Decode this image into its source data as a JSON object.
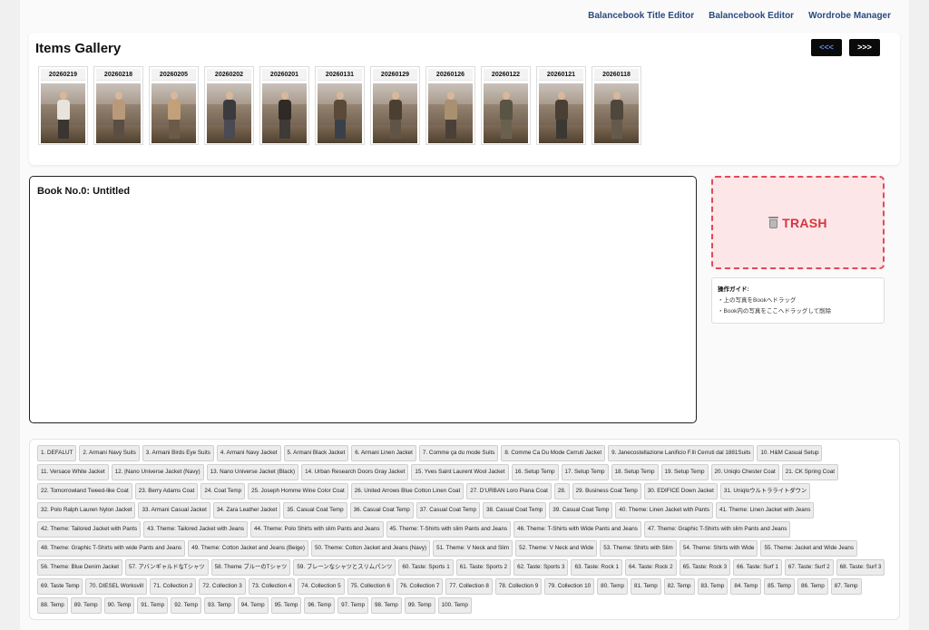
{
  "nav": {
    "links": [
      "Balancebook Title Editor",
      "Balancebook Editor",
      "Wordrobe Manager"
    ]
  },
  "gallery": {
    "title": "Items Gallery",
    "prev_label": "<<<",
    "next_label": ">>>",
    "items": [
      {
        "date": "20260219",
        "coat": "#e8e3dc",
        "pants": "#3a3530"
      },
      {
        "date": "20260218",
        "coat": "#b89a7a",
        "pants": "#5a4e43"
      },
      {
        "date": "20260205",
        "coat": "#c2a07a",
        "pants": "#6b5a48"
      },
      {
        "date": "20260202",
        "coat": "#3b3a3c",
        "pants": "#4a4a52"
      },
      {
        "date": "20260201",
        "coat": "#2f2a26",
        "pants": "#3d3a37"
      },
      {
        "date": "20260131",
        "coat": "#5b4a38",
        "pants": "#394049"
      },
      {
        "date": "20260129",
        "coat": "#4b3f31",
        "pants": "#5f5446"
      },
      {
        "date": "20260126",
        "coat": "#a89070",
        "pants": "#4a4038"
      },
      {
        "date": "20260122",
        "coat": "#5a5445",
        "pants": "#6a604e"
      },
      {
        "date": "20260121",
        "coat": "#4a3f34",
        "pants": "#3b3834"
      },
      {
        "date": "20260118",
        "coat": "#4f473c",
        "pants": "#645a4c"
      }
    ]
  },
  "book": {
    "title": "Book No.0: Untitled"
  },
  "trash": {
    "label": "TRASH"
  },
  "guide": {
    "title": "操作ガイド:",
    "lines": [
      "・上の写真をBookへドラッグ",
      "・Book内の写真をここへドラッグして削除"
    ]
  },
  "books": [
    "1. DEFALUT",
    "2. Armani Navy Suits",
    "3. Armani Birds Eye Suits",
    "4. Armani Navy Jacket",
    "5. Armani Black Jacket",
    "6. Armani Linen Jacket",
    "7. Comme ça du mode Suits",
    "8. Comme Ca Du Mode Cerruti Jacket",
    "9. Janecostellazione Lanificio F.lli Cerruti dal 1881Suits",
    "10. H&M Casual Setup",
    "11. Versace White Jacket",
    "12. |Nano Universe Jacket (Navy)",
    "13. Nano Universe Jacket (Black)",
    "14. Urban Research Doors Gray Jacket",
    "15. Yves Saint Laurent Wool Jacket",
    "16. Setup Temp",
    "17. Setup Temp",
    "18. Setup Temp",
    "19. Setup Temp",
    "20. Uniqlo Chester Coat",
    "21. CK Spring Coat",
    "22. Tomorrowland Tweed-like Coat",
    "23. Berry Adams Coat",
    "24. Coat Temp",
    "25. Joseph Homme Wine Color Coat",
    "26. United Arrows Blue Cotton Linen Coat",
    "27. D'URBAN Loro Piana Coat",
    "28.",
    "29. Business Coat Temp",
    "30. EDIFICE Down Jacket",
    "31. Uniqloウルトラライトダウン",
    "32. Polo Ralph Lauren Nylon Jacket",
    "33. Armani Casual Jacket",
    "34. Zara Leather Jacket",
    "35. Casual Coat Temp",
    "36. Casual Coat Temp",
    "37. Casual Coat Temp",
    "38. Casual Coat Temp",
    "39. Casual Coat Temp",
    "40. Theme: Linen Jacket with Pants",
    "41. Theme: Linen Jacket with Jeans",
    "42. Theme: Tailored Jacket with Pants",
    "43. Theme: Tailored Jacket with Jeans",
    "44. Theme: Polo Shirts with slim Pants and Jeans",
    "45. Theme: T-Shirts with slim Pants and Jeans",
    "46. Theme: T-Shirts with Wide Pants and Jeans",
    "47. Theme: Graphic T-Shirts with slim Pants and Jeans",
    "48. Theme: Graphic T-Shirts with wide Pants and Jeans",
    "49. Theme: Cotton Jacket and Jeans (Beige)",
    "50. Theme: Cotton Jacket and Jeans (Navy)",
    "51. Theme: V Neck and Slim",
    "52. Theme: V Neck and Wide",
    "53. Theme: Shirts with Slim",
    "54. Theme: Shirts with Wide",
    "55. Theme: Jacket and Wide Jeans",
    "56. Theme: Blue Denim Jacket",
    "57. アバンギャルドなTシャツ",
    "58. Theme ブルーのTシャツ",
    "59. プレーンなシャツとスリムパンツ",
    "60. Taste: Sports 1",
    "61. Taste: Sports 2",
    "62. Taste: Sports 3",
    "63. Taste: Rock 1",
    "64. Taste: Rock 2",
    "65. Taste: Rock 3",
    "66. Taste: Surf 1",
    "67. Taste: Surf 2",
    "68. Taste: Surf 3",
    "69. Taste Temp",
    "70. DIESEL Worksvill",
    "71. Collection 2",
    "72. Collection 3",
    "73. Collection 4",
    "74. Collection 5",
    "75. Collection 6",
    "76. Collection 7",
    "77. Collection 8",
    "78. Collection 9",
    "79. Collection 10",
    "80. Temp",
    "81. Temp",
    "82. Temp",
    "83. Temp",
    "84. Temp",
    "85. Temp",
    "86. Temp",
    "87. Temp",
    "88. Temp",
    "89. Temp",
    "90. Temp",
    "91. Temp",
    "92. Temp",
    "93. Temp",
    "94. Temp",
    "95. Temp",
    "96. Temp",
    "97. Temp",
    "98. Temp",
    "99. Temp",
    "100. Temp"
  ]
}
